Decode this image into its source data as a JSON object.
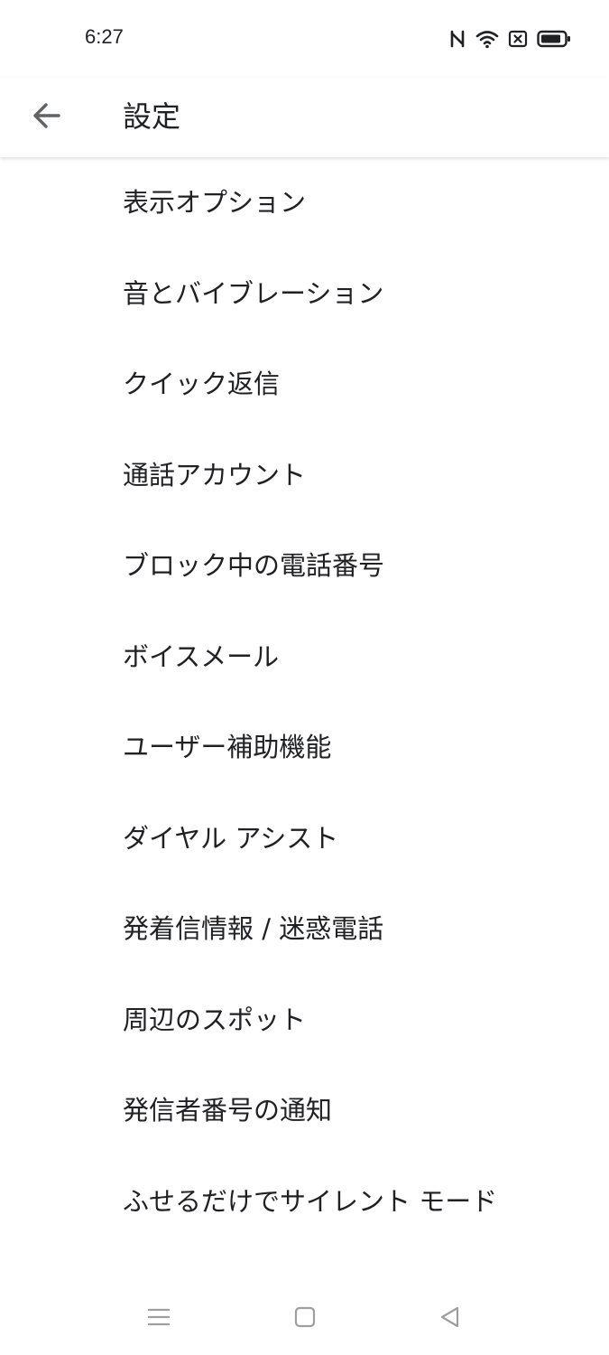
{
  "status_bar": {
    "time": "6:27",
    "icons": [
      "nfc-icon",
      "wifi-icon",
      "no-sim-icon",
      "battery-icon"
    ]
  },
  "app_bar": {
    "title": "設定",
    "back_icon": "arrow-back-icon"
  },
  "settings": {
    "items": [
      {
        "label": "表示オプション"
      },
      {
        "label": "音とバイブレーション"
      },
      {
        "label": "クイック返信"
      },
      {
        "label": "通話アカウント"
      },
      {
        "label": "ブロック中の電話番号"
      },
      {
        "label": "ボイスメール"
      },
      {
        "label": "ユーザー補助機能"
      },
      {
        "label": "ダイヤル アシスト"
      },
      {
        "label": "発着信情報 / 迷惑電話"
      },
      {
        "label": "周辺のスポット"
      },
      {
        "label": "発信者番号の通知"
      },
      {
        "label": "ふせるだけでサイレント モード"
      }
    ]
  },
  "nav_bar": {
    "icons": [
      "menu-icon",
      "home-square-icon",
      "back-triangle-icon"
    ]
  },
  "colors": {
    "text_primary": "#202124",
    "icon_gray": "#5f6368",
    "nav_gray": "#9e9e9e",
    "background": "#ffffff"
  }
}
